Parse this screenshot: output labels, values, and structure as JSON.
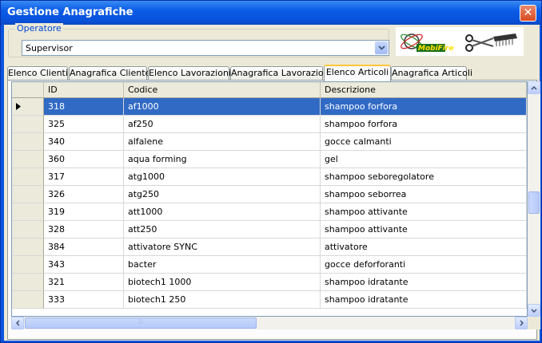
{
  "window": {
    "title": "Gestione Anagrafiche",
    "close_glyph": "✕"
  },
  "operator": {
    "label": "Operatore",
    "value": "Supervisor"
  },
  "tabs": [
    "Elenco Clienti",
    "Anagrafica Cliente",
    "Elenco Lavorazioni",
    "Anagrafica Lavorazioni",
    "Elenco Articoli",
    "Anagrafica Articoli"
  ],
  "active_tab": 4,
  "grid": {
    "columns": [
      "ID",
      "Codice",
      "Descrizione"
    ],
    "selected_row": 0,
    "rows": [
      [
        "318",
        "af1000",
        "shampoo forfora"
      ],
      [
        "325",
        "af250",
        "shampoo forfora"
      ],
      [
        "340",
        "alfalene",
        "gocce calmanti"
      ],
      [
        "360",
        "aqua forming",
        "gel"
      ],
      [
        "317",
        "atg1000",
        "shampoo seboregolatore"
      ],
      [
        "326",
        "atg250",
        "shampoo seborrea"
      ],
      [
        "319",
        "att1000",
        "shampoo attivante"
      ],
      [
        "328",
        "att250",
        "shampoo attivante"
      ],
      [
        "384",
        "attivatore SYNC",
        "attivatore"
      ],
      [
        "343",
        "bacter",
        "gocce deforforanti"
      ],
      [
        "321",
        "biotech1 1000",
        "shampoo idratante"
      ],
      [
        "333",
        "biotech1 250",
        "shampoo idratante"
      ]
    ]
  },
  "colors": {
    "selection": "#316ac5",
    "title_bar": "#0a55e0"
  }
}
